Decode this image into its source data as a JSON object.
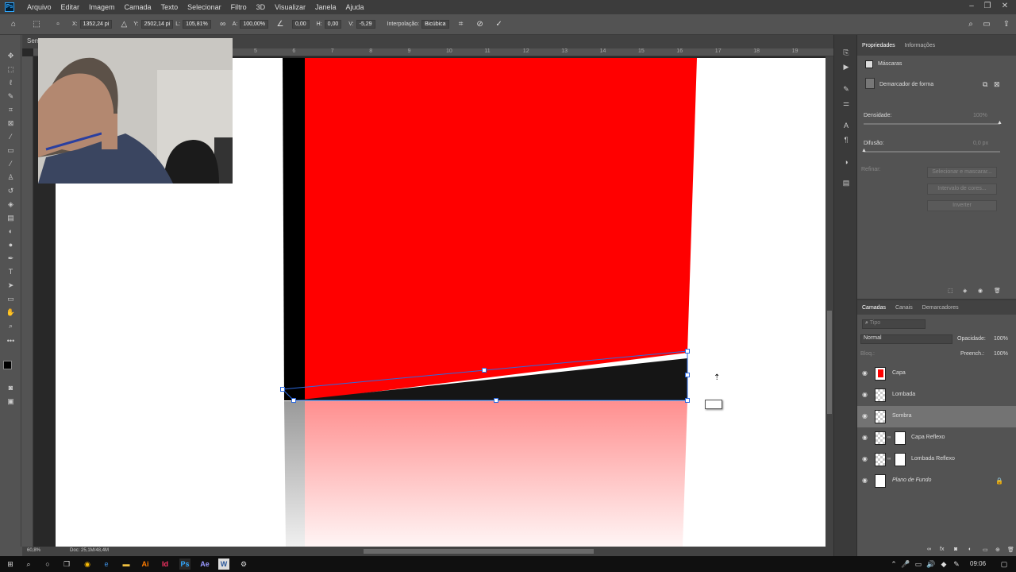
{
  "menu": {
    "app_icon": "Ps",
    "items": [
      "Arquivo",
      "Editar",
      "Imagem",
      "Camada",
      "Texto",
      "Selecionar",
      "Filtro",
      "3D",
      "Visualizar",
      "Janela",
      "Ajuda"
    ]
  },
  "options": {
    "x_label": "X:",
    "x_value": "1352,24 pi",
    "y_label": "Y:",
    "y_value": "2502,14 pi",
    "w_label": "L:",
    "w_value": "105,81%",
    "h_label": "A:",
    "h_value": "100,00%",
    "angle_value": "0,00",
    "hskew_label": "H:",
    "hskew_value": "0,00",
    "vskew_label": "V:",
    "vskew_value": "-5,29",
    "interp_label": "Interpolação:",
    "interp_value": "Bicúbica"
  },
  "document": {
    "tab_label": "Sem",
    "zoom": "60,8%",
    "doc_info": "Doc: 25,1M/48,4M",
    "ruler_numbers": [
      "5",
      "6",
      "7",
      "8",
      "9",
      "10",
      "11",
      "12",
      "13",
      "14",
      "15",
      "16",
      "17",
      "18",
      "19"
    ]
  },
  "properties_panel": {
    "tab_active": "Propriedades",
    "tab_other": "Informações",
    "section": "Máscaras",
    "item": "Demarcador de forma",
    "density_label": "Densidade:",
    "density_value": "100%",
    "feather_label": "Difusão:",
    "feather_value": "0,0 px",
    "refine_label": "Refinar:",
    "btn_select_mask": "Selecionar e mascarar...",
    "btn_color_range": "Intervalo de cores...",
    "btn_invert": "Inverter"
  },
  "layers_panel": {
    "tabs": [
      "Camadas",
      "Canais",
      "Demarcadores"
    ],
    "search_placeholder": "Tipo",
    "blend_mode": "Normal",
    "opacity_label": "Opacidade:",
    "opacity_value": "100%",
    "lock_label": "Bloq.:",
    "fill_label": "Preench.:",
    "fill_value": "100%",
    "layers": [
      {
        "name": "Capa",
        "selected": false,
        "thumb": "red"
      },
      {
        "name": "Lombada",
        "selected": false,
        "thumb": "checker"
      },
      {
        "name": "Sombra",
        "selected": true,
        "thumb": "checker"
      },
      {
        "name": "Capa Reflexo",
        "selected": false,
        "thumb": "mask"
      },
      {
        "name": "Lombada Reflexo",
        "selected": false,
        "thumb": "mask"
      },
      {
        "name": "Plano de Fundo",
        "selected": false,
        "thumb": "white"
      }
    ]
  },
  "taskbar": {
    "time": "09:06"
  },
  "colors": {
    "red": "#ff0000",
    "black": "#000000",
    "accent": "#31a8ff"
  }
}
